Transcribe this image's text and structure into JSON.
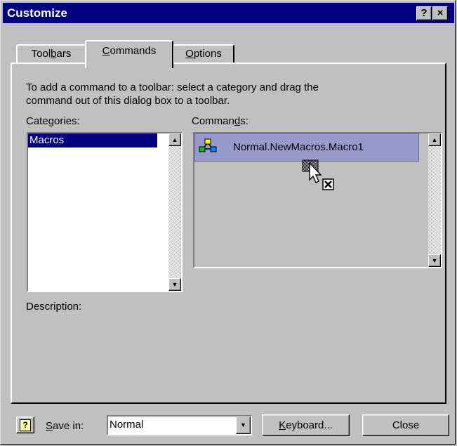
{
  "window": {
    "title": "Customize",
    "help_glyph": "?",
    "close_glyph": "×"
  },
  "tabs": [
    {
      "pre": "Tool",
      "key": "b",
      "post": "ars"
    },
    {
      "pre": "",
      "key": "C",
      "post": "ommands"
    },
    {
      "pre": "",
      "key": "O",
      "post": "ptions"
    }
  ],
  "instructions": {
    "line1": "To add a command to a toolbar: select a category and drag the",
    "line2": "command out of this dialog box to a toolbar."
  },
  "categories": {
    "pre": "Cate",
    "key": "g",
    "post": "ories:",
    "items": [
      "Macros"
    ]
  },
  "commands": {
    "pre": "Comman",
    "key": "d",
    "post": "s:",
    "items": [
      "Normal.NewMacros.Macro1"
    ]
  },
  "description_label": "Description:",
  "footer": {
    "help_glyph": "?",
    "save_pre": "",
    "save_key": "S",
    "save_post": "ave in:",
    "save_value": "Normal",
    "keyboard_key": "K",
    "keyboard_post": "eyboard...",
    "close_label": "Close"
  },
  "colors": {
    "titlebar": "#000080",
    "face": "#c0c0c0",
    "selection": "#000080",
    "drag_highlight": "#9999cc"
  },
  "icons": [
    "macro-icon",
    "drag-cursor-icon",
    "help-icon"
  ]
}
